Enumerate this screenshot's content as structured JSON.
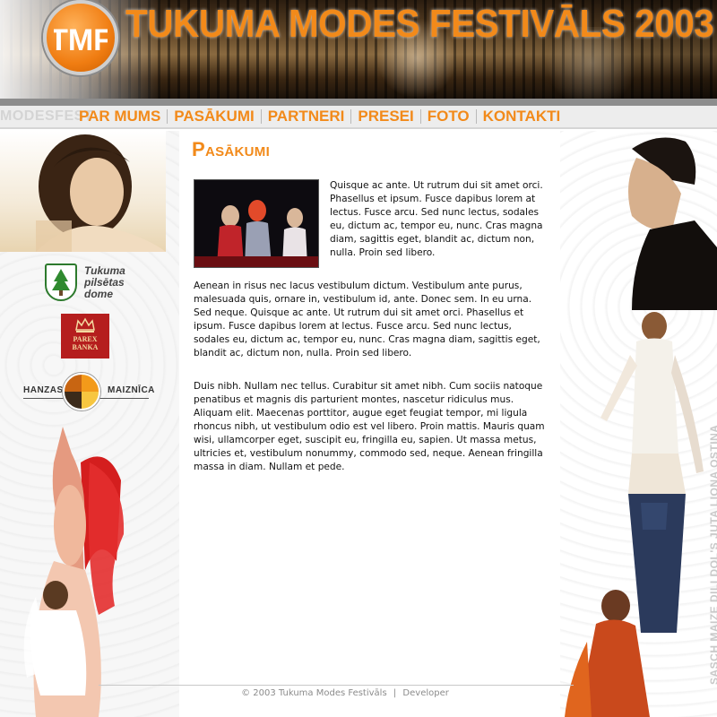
{
  "header": {
    "site_title": "TUKUMA MODES FESTIVĀLS 2003",
    "logo_text": "TMF"
  },
  "nav": {
    "watermark": "MODESFEST",
    "items": [
      {
        "label": "PAR MUMS"
      },
      {
        "label": "PASĀKUMI"
      },
      {
        "label": "PARTNERI"
      },
      {
        "label": "PRESEI"
      },
      {
        "label": "FOTO"
      },
      {
        "label": "KONTAKTI"
      }
    ]
  },
  "sponsors": {
    "tukums": {
      "line1": "Tukuma",
      "line2": "pilsētas",
      "line3": "dome"
    },
    "parex": {
      "line1": "PAREX",
      "line2": "BANKA"
    },
    "hanzas": {
      "left": "HANZAS",
      "right": "MAIZNĪCA"
    }
  },
  "main": {
    "title": "Pasākumi",
    "paragraphs": [
      "Quisque ac ante. Ut rutrum dui sit amet orci. Phasellus et ipsum. Fusce dapibus lorem at lectus. Fusce arcu. Sed nunc lectus, sodales eu, dictum ac, tempor eu, nunc. Cras magna diam, sagittis eget, blandit ac, dictum non, nulla. Proin sed libero.",
      "Aenean in risus nec lacus vestibulum dictum. Vestibulum ante purus, malesuada quis, ornare in, vestibulum id, ante. Donec sem. In eu urna. Sed neque. Quisque ac ante. Ut rutrum dui sit amet orci. Phasellus et ipsum. Fusce dapibus lorem at lectus. Fusce arcu. Sed nunc lectus, sodales eu, dictum ac, tempor eu, nunc. Cras magna diam, sagittis eget, blandit ac, dictum non, nulla. Proin sed libero.",
      "Duis nibh. Nullam nec tellus. Curabitur sit amet nibh. Cum sociis natoque penatibus et magnis dis parturient montes, nascetur ridiculus mus. Aliquam elit. Maecenas porttitor, augue eget feugiat tempor, mi ligula rhoncus nibh, ut vestibulum odio est vel libero. Proin mattis. Mauris quam wisi, ullamcorper eget, suscipit eu, fringilla eu, sapien. Ut massa metus, ultricies et, vestibulum nonummy, commodo sed, neque. Aenean fringilla massa in diam. Nullam et pede."
    ]
  },
  "side_caption": "SASCH MAIZE DILI DOL'S JUTA LIONA OSTINA",
  "footer": {
    "copyright": "© 2003 Tukuma Modes Festivāls",
    "separator": "|",
    "developer_link": "Developer"
  },
  "colors": {
    "accent": "#f28a1a",
    "nav_bg": "#ededed",
    "footer_text": "#8b8b8b"
  }
}
